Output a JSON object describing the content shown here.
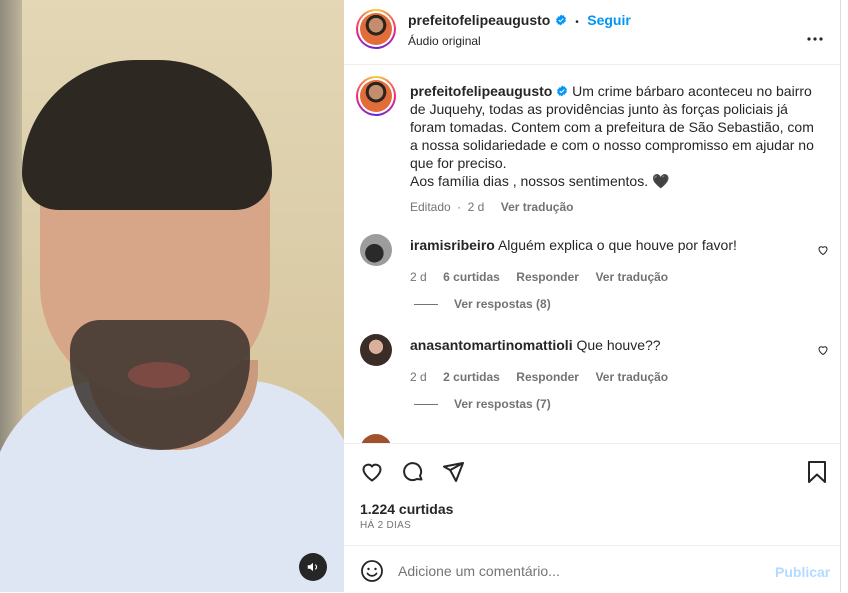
{
  "post": {
    "username": "prefeitofelipeaugusto",
    "follow_label": "Seguir",
    "separator": "•",
    "audio_label": "Áudio original",
    "caption_lines": [
      "Um crime bárbaro aconteceu no bairro",
      "de Juquehy, todas as providências junto às forças policiais já",
      "foram tomadas. Contem com a prefeitura de São Sebastião, com",
      "a nossa solidariedade e com o nosso compromisso em ajudar no",
      "que for preciso.",
      "Aos família dias , nossos sentimentos. 🖤"
    ],
    "caption_meta": {
      "edited": "Editado",
      "dot": "·",
      "time": "2 d",
      "translate": "Ver tradução"
    }
  },
  "comments": [
    {
      "username": "iramisribeiro",
      "text": "Alguém explica o que houve por favor!",
      "time": "2 d",
      "likes": "6 curtidas",
      "reply": "Responder",
      "translate": "Ver tradução",
      "view_replies": "Ver respostas (8)"
    },
    {
      "username": "anasantomartinomattioli",
      "text": "Que houve??",
      "time": "2 d",
      "likes": "2 curtidas",
      "reply": "Responder",
      "translate": "Ver tradução",
      "view_replies": "Ver respostas (7)"
    }
  ],
  "footer": {
    "likes": "1.224 curtidas",
    "date": "HÁ 2 DIAS",
    "add_comment_placeholder": "Adicione um comentário...",
    "publish_label": "Publicar"
  },
  "colors": {
    "accent": "#0095f6",
    "verified": "#0095f6"
  }
}
